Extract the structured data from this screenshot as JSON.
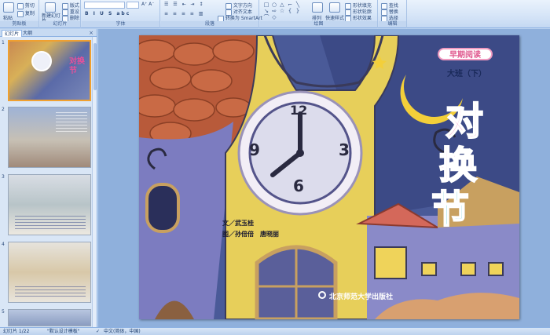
{
  "ribbon": {
    "groups": [
      {
        "label": "剪贴板",
        "buttons": [
          "粘贴",
          "剪切",
          "复制",
          "格式刷"
        ]
      },
      {
        "label": "幻灯片",
        "buttons": [
          "新建幻灯片",
          "版式",
          "重设",
          "删除"
        ]
      },
      {
        "label": "字体",
        "buttons": []
      },
      {
        "label": "段落",
        "buttons": [
          "文字方向",
          "对齐文本",
          "转换为 SmartArt"
        ]
      },
      {
        "label": "绘图",
        "buttons": [
          "排列",
          "快速样式",
          "形状填充",
          "形状轮廓",
          "形状效果"
        ]
      },
      {
        "label": "编辑",
        "buttons": [
          "查找",
          "替换",
          "选择"
        ]
      }
    ]
  },
  "leftpane": {
    "tab_slides": "幻灯片",
    "tab_outline": "大纲",
    "close": "×",
    "thumbnails": [
      {
        "num": "1"
      },
      {
        "num": "2"
      },
      {
        "num": "3"
      },
      {
        "num": "4"
      },
      {
        "num": "5"
      }
    ]
  },
  "slide": {
    "series_badge": "早期阅读",
    "grade": "大班（下）",
    "title_chars": [
      "对",
      "换",
      "节"
    ],
    "clock_numbers": [
      "12",
      "3",
      "6",
      "9"
    ],
    "author_text": "文／武玉桂",
    "illustrator_text": "图／孙倍倍　唐晓丽",
    "publisher": "北京师范大学出版社"
  },
  "status": {
    "slide_info": "幻灯片 1/22",
    "theme": "\"默认设计模板\"",
    "language": "中文(简体，中国)"
  },
  "colors": {
    "ribbon_bg": "#d5e4f7",
    "title_pink": "#e8509a",
    "title_teal": "#28b4c8",
    "moon": "#f3cf3a"
  }
}
